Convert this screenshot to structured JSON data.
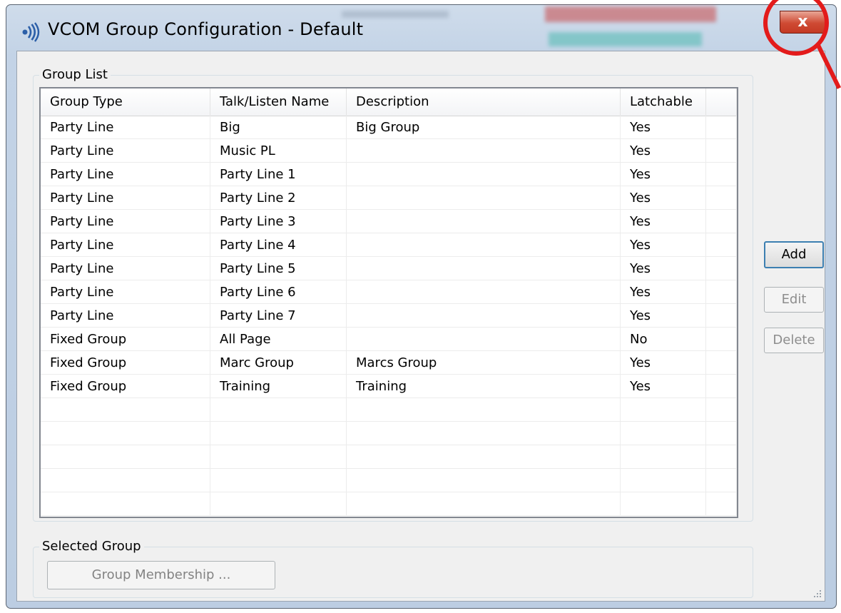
{
  "window": {
    "title": "VCOM Group Configuration - Default",
    "close_glyph": "x",
    "app_icon": "vcom-app-icon"
  },
  "group_list": {
    "legend": "Group List",
    "columns": [
      "Group Type",
      "Talk/Listen Name",
      "Description",
      "Latchable"
    ],
    "rows": [
      [
        "Party Line",
        "Big",
        "Big Group",
        "Yes"
      ],
      [
        "Party Line",
        "Music PL",
        "",
        "Yes"
      ],
      [
        "Party Line",
        "Party Line 1",
        "",
        "Yes"
      ],
      [
        "Party Line",
        "Party Line 2",
        "",
        "Yes"
      ],
      [
        "Party Line",
        "Party Line 3",
        "",
        "Yes"
      ],
      [
        "Party Line",
        "Party Line 4",
        "",
        "Yes"
      ],
      [
        "Party Line",
        "Party Line 5",
        "",
        "Yes"
      ],
      [
        "Party Line",
        "Party Line 6",
        "",
        "Yes"
      ],
      [
        "Party Line",
        "Party Line 7",
        "",
        "Yes"
      ],
      [
        "Fixed Group",
        "All Page",
        "",
        "No"
      ],
      [
        "Fixed Group",
        "Marc Group",
        "Marcs Group",
        "Yes"
      ],
      [
        "Fixed Group",
        "Training",
        "Training",
        "Yes"
      ]
    ],
    "empty_rows": 5
  },
  "buttons": {
    "add": "Add",
    "edit": "Edit",
    "delete": "Delete"
  },
  "selected_group": {
    "legend": "Selected Group",
    "membership_button": "Group Membership ..."
  },
  "colors": {
    "annotation": "#e31b1b",
    "close_button": "#cf4a33",
    "default_button_border": "#3c7fb1",
    "disabled_text": "#8d8d8d"
  }
}
